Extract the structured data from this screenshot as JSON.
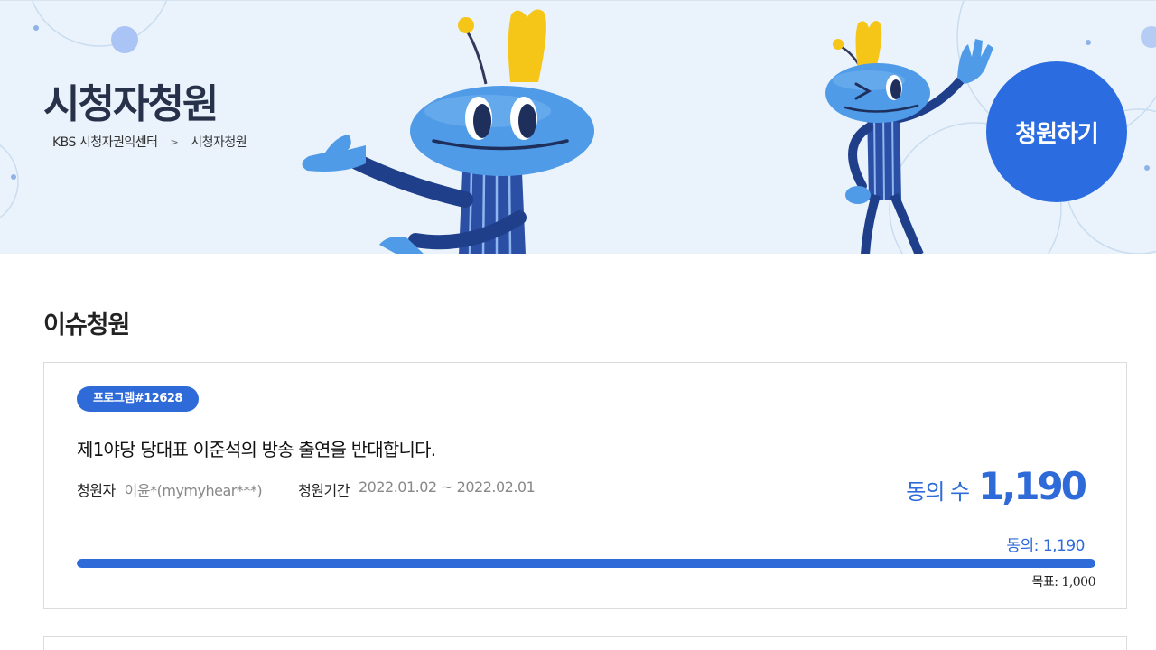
{
  "hero": {
    "title": "시청자청원",
    "breadcrumb": [
      "KBS 시청자권익센터",
      "시청자청원"
    ],
    "breadcrumb_sep": ">",
    "cta_label": "청원하기"
  },
  "section": {
    "title": "이슈청원"
  },
  "petition": {
    "badge": "프로그램#12628",
    "title": "제1야당 당대표 이준석의 방송 출연을 반대합니다.",
    "petitioner_label": "청원자",
    "petitioner_value": "이윤*(mymyhear***)",
    "period_label": "청원기간",
    "period_value": "2022.01.02 ~ 2022.02.01",
    "agree_label": "동의 수",
    "agree_count": "1,190",
    "agree_small": "동의: 1,190",
    "goal": "목표: 1,000",
    "progress": 1.0
  },
  "colors": {
    "accent": "#2f6ad9",
    "hero_bg": "#eaf3fb",
    "mascot_body": "#4f9be8",
    "mascot_dark": "#1f3f8a",
    "crown": "#f5c518"
  },
  "icons": [
    "mascot-left-image",
    "mascot-right-image"
  ]
}
